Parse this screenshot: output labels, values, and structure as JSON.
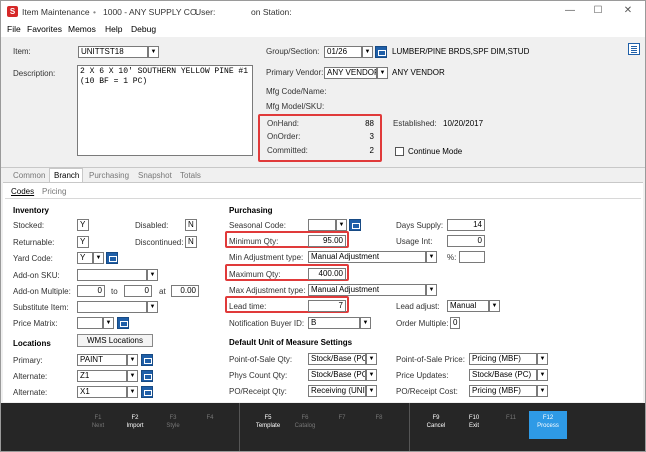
{
  "titlebar": {
    "app_name": "Item Maintenance",
    "company": "1000 - ANY SUPPLY CO.",
    "user_label": "User:",
    "station_label": "on Station:"
  },
  "menu": [
    "File",
    "Favorites",
    "Memos",
    "Help",
    "Debug"
  ],
  "header": {
    "item_label": "Item:",
    "item_value": "UNITTST18",
    "description_label": "Description:",
    "description_value": "2 X 6 X 10' SOUTHERN YELLOW PINE #1 (10 BF = 1 PC)",
    "group_label": "Group/Section:",
    "group_value": "01/26",
    "group_desc": "LUMBER/PINE BRDS,SPF DIM,STUD",
    "vendor_label": "Primary Vendor:",
    "vendor_value": "ANY VENDOR",
    "vendor_desc": "ANY VENDOR",
    "mfg_code_label": "Mfg Code/Name:",
    "mfg_model_label": "Mfg Model/SKU:",
    "onhand_label": "OnHand:",
    "onhand_value": "88",
    "onorder_label": "OnOrder:",
    "onorder_value": "3",
    "committed_label": "Committed:",
    "committed_value": "2",
    "established_label": "Established:",
    "established_value": "10/20/2017",
    "continue_mode_label": "Continue Mode"
  },
  "tabs": [
    "Common",
    "Branch",
    "Purchasing",
    "Snapshot",
    "Totals"
  ],
  "subtabs": [
    "Codes",
    "Pricing"
  ],
  "inventory": {
    "title": "Inventory",
    "stocked_label": "Stocked:",
    "stocked_value": "Y",
    "disabled_label": "Disabled:",
    "disabled_value": "N",
    "returnable_label": "Returnable:",
    "returnable_value": "Y",
    "discontinued_label": "Discontinued:",
    "discontinued_value": "N",
    "yard_code_label": "Yard Code:",
    "yard_code_value": "Y",
    "addon_sku_label": "Add-on SKU:",
    "addon_multiple_label": "Add-on Multiple:",
    "addon_from": "0",
    "to_label": "to",
    "addon_to": "0",
    "at_label": "at",
    "addon_at": "0.00",
    "substitute_label": "Substitute Item:",
    "price_matrix_label": "Price Matrix:"
  },
  "locations": {
    "title": "Locations",
    "wms_button": "WMS Locations",
    "primary_label": "Primary:",
    "primary_value": "PAINT",
    "alternate1_label": "Alternate:",
    "alternate1_value": "Z1",
    "alternate2_label": "Alternate:",
    "alternate2_value": "X1"
  },
  "purchasing": {
    "title": "Purchasing",
    "seasonal_label": "Seasonal Code:",
    "days_supply_label": "Days Supply:",
    "days_supply_value": "14",
    "min_qty_label": "Minimum Qty:",
    "min_qty_value": "95.00",
    "usage_int_label": "Usage Int:",
    "usage_int_value": "0",
    "min_adj_label": "Min Adjustment type:",
    "min_adj_value": "Manual Adjustment",
    "pct_label": "%:",
    "max_qty_label": "Maximum Qty:",
    "max_qty_value": "400.00",
    "max_adj_label": "Max Adjustment type:",
    "max_adj_value": "Manual Adjustment",
    "lead_time_label": "Lead time:",
    "lead_time_value": "7",
    "lead_adjust_label": "Lead adjust:",
    "lead_adjust_value": "Manual",
    "notify_label": "Notification Buyer ID:",
    "notify_value": "B",
    "order_multiple_label": "Order Multiple:",
    "order_multiple_value": "0"
  },
  "uom": {
    "title": "Default Unit of Measure Settings",
    "pos_qty_label": "Point-of-Sale Qty:",
    "pos_qty_value": "Stock/Base (PC)",
    "pos_price_label": "Point-of-Sale Price:",
    "pos_price_value": "Pricing (MBF)",
    "phys_count_label": "Phys Count Qty:",
    "phys_count_value": "Stock/Base (PC)",
    "price_updates_label": "Price Updates:",
    "price_updates_value": "Stock/Base (PC)",
    "po_qty_label": "PO/Receipt Qty:",
    "po_qty_value": "Receiving (UNIT)",
    "po_cost_label": "PO/Receipt Cost:",
    "po_cost_value": "Pricing (MBF)"
  },
  "fkeys": [
    {
      "key": "F1",
      "label": "Next"
    },
    {
      "key": "F2",
      "label": "Import"
    },
    {
      "key": "F3",
      "label": "Style"
    },
    {
      "key": "F4",
      "label": ""
    },
    {
      "key": "F5",
      "label": "Template"
    },
    {
      "key": "F6",
      "label": "Catalog"
    },
    {
      "key": "F7",
      "label": ""
    },
    {
      "key": "F8",
      "label": ""
    },
    {
      "key": "F9",
      "label": "Cancel"
    },
    {
      "key": "F10",
      "label": "Exit"
    },
    {
      "key": "F11",
      "label": ""
    },
    {
      "key": "F12",
      "label": "Process"
    }
  ],
  "colors": {
    "accent": "#1f5fa8",
    "highlight": "#e03a3a",
    "fbar": "#262626",
    "process": "#2e9ae6"
  }
}
